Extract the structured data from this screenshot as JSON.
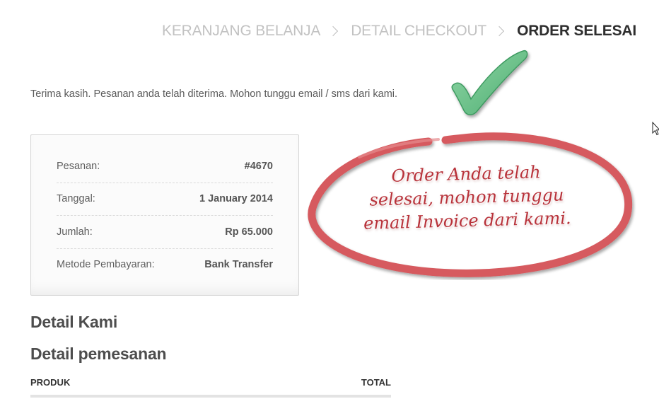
{
  "breadcrumb": {
    "steps": [
      {
        "label": "KERANJANG BELANJA"
      },
      {
        "label": "DETAIL CHECKOUT"
      },
      {
        "label": "ORDER SELESAI"
      }
    ]
  },
  "message": "Terima kasih. Pesanan anda telah diterima. Mohon tunggu email / sms dari kami.",
  "order_summary": {
    "rows": [
      {
        "label": "Pesanan:",
        "value": "#4670"
      },
      {
        "label": "Tanggal:",
        "value": "1 January 2014"
      },
      {
        "label": "Jumlah:",
        "value": "Rp 65.000"
      },
      {
        "label": "Metode Pembayaran:",
        "value": "Bank Transfer"
      }
    ]
  },
  "headings": {
    "detail_kami": "Detail Kami",
    "detail_pemesanan": "Detail pemesanan"
  },
  "order_table": {
    "columns": [
      "PRODUK",
      "TOTAL"
    ]
  },
  "annotation": {
    "text": "Order Anda telah selesai, mohon tunggu email Invoice dari kami.",
    "check_icon": "checkmark-icon",
    "colors": {
      "check": "#6cc08a",
      "ellipse": "#d65a5e",
      "text": "#b8323a"
    }
  },
  "colors": {
    "breadcrumb_inactive": "#c2c2c2",
    "breadcrumb_active": "#2e2e2e"
  }
}
